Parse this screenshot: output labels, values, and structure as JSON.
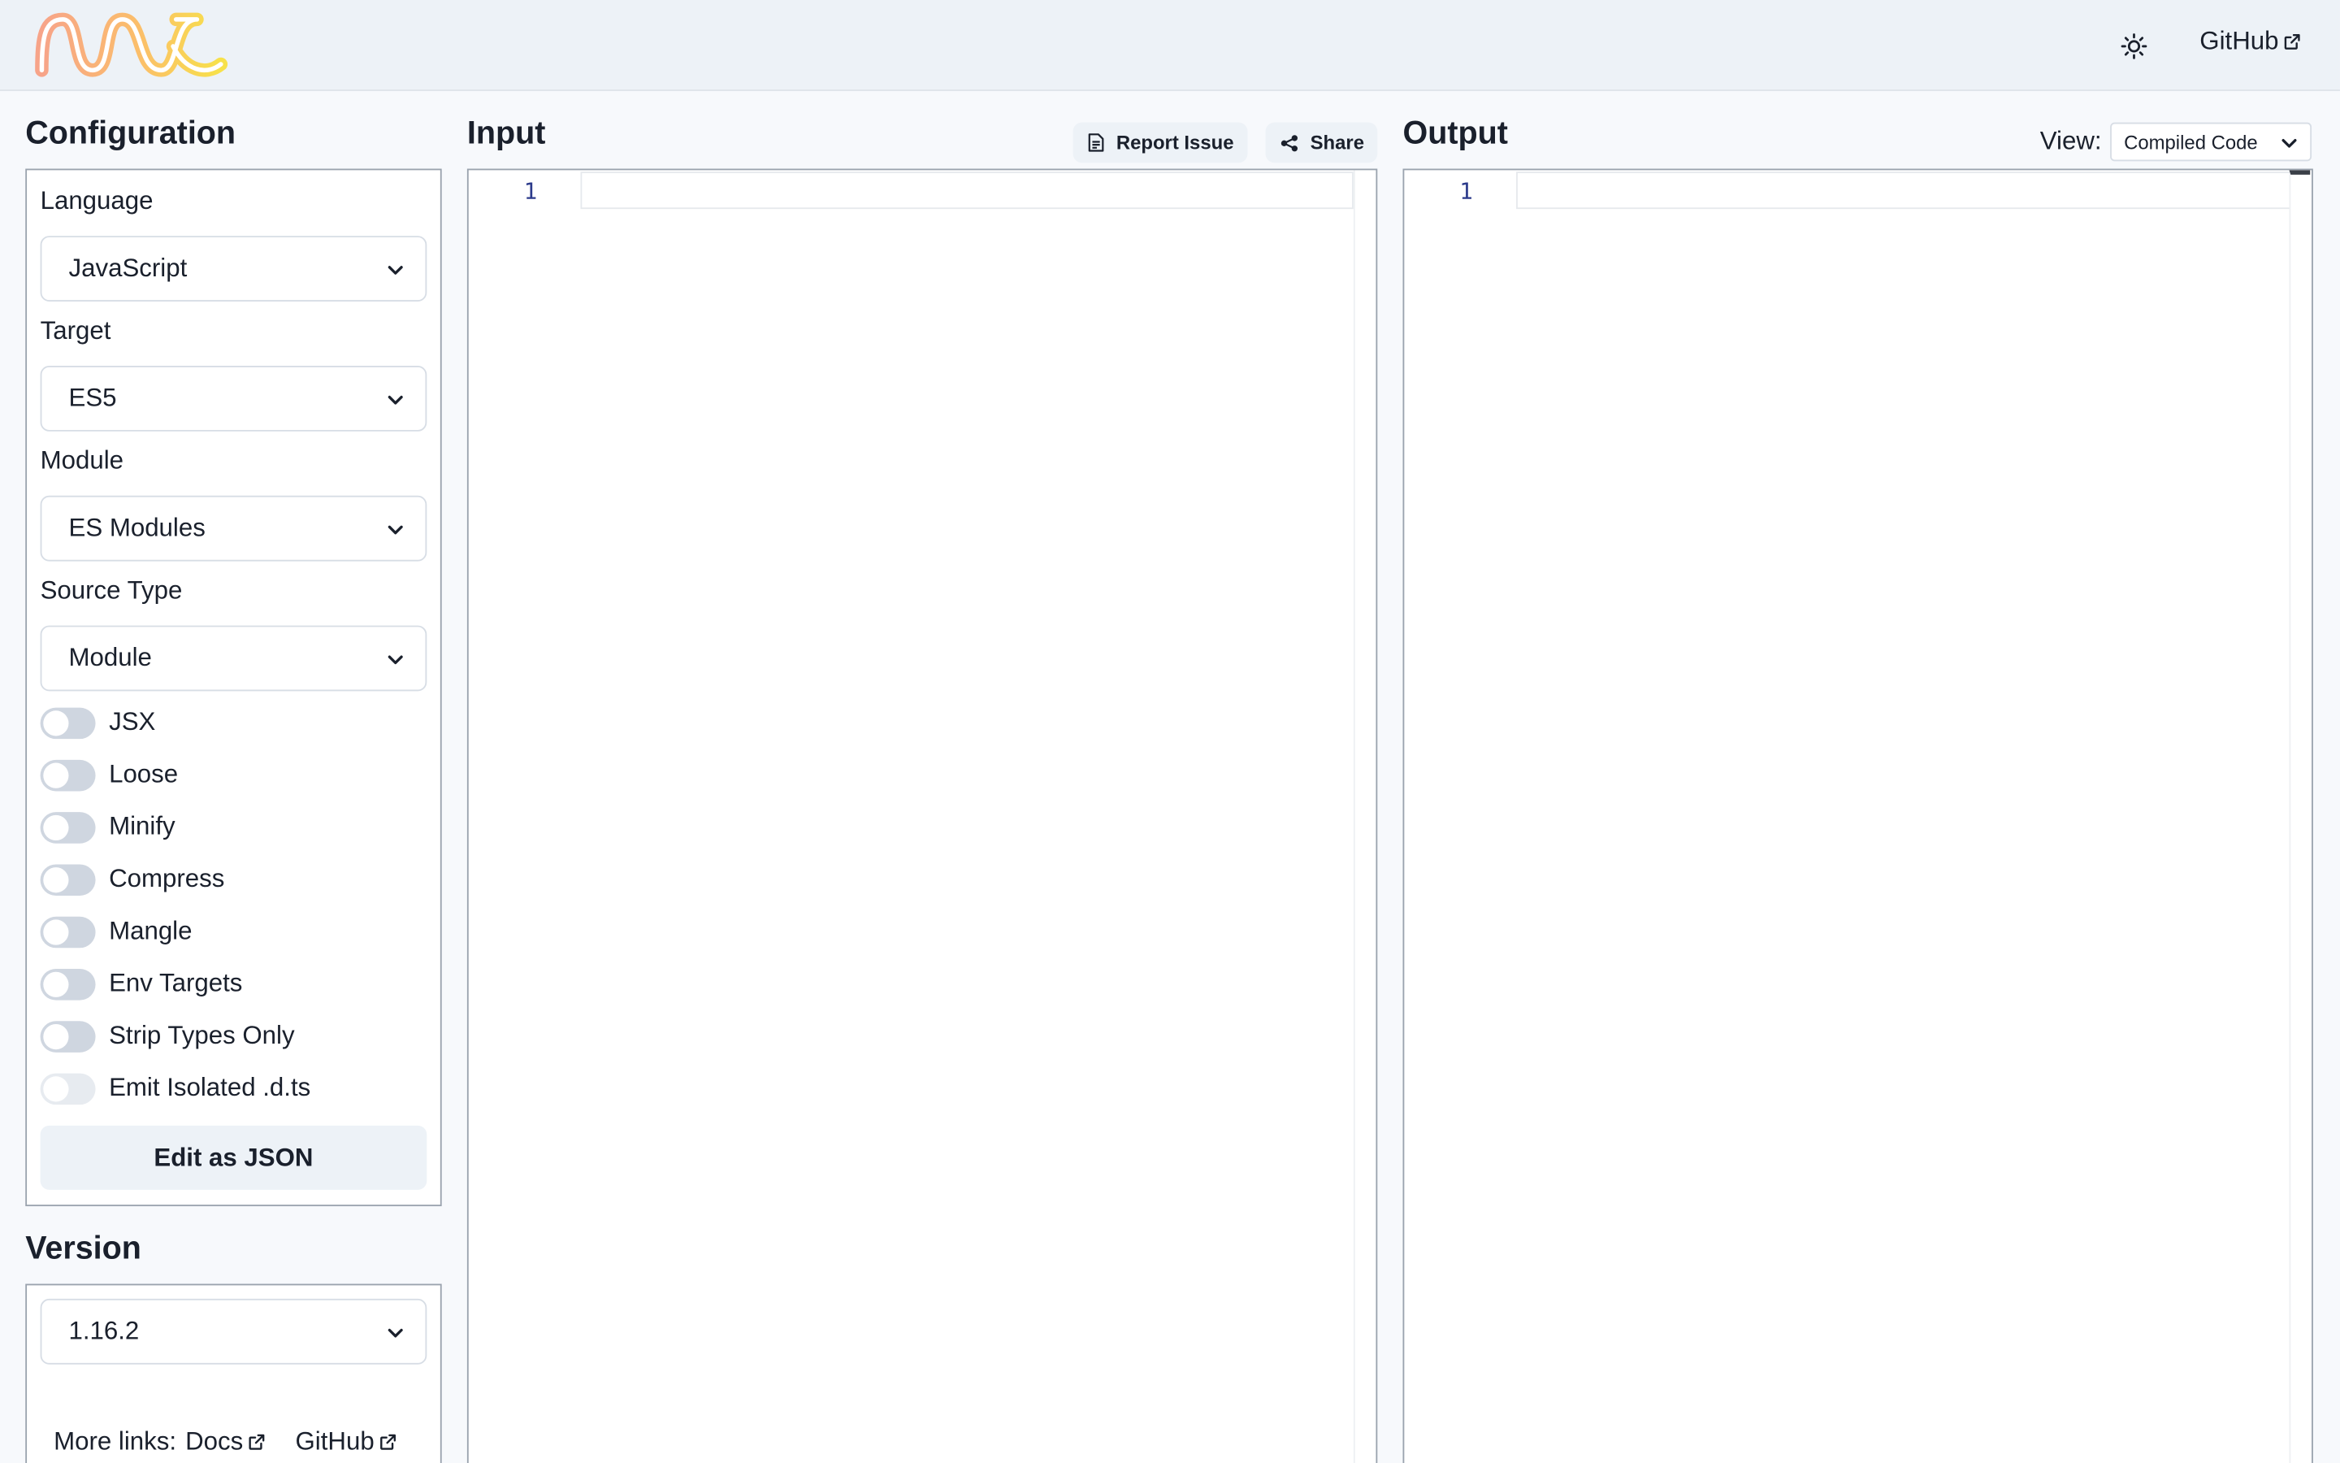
{
  "header": {
    "logo_icon": "swc-logo",
    "theme_icon": "sun-icon",
    "github_label": "GitHub"
  },
  "configuration": {
    "title": "Configuration",
    "language": {
      "label": "Language",
      "value": "JavaScript"
    },
    "target": {
      "label": "Target",
      "value": "ES5"
    },
    "module": {
      "label": "Module",
      "value": "ES Modules"
    },
    "source_type": {
      "label": "Source Type",
      "value": "Module"
    },
    "toggles": [
      {
        "label": "JSX",
        "checked": false,
        "disabled": false
      },
      {
        "label": "Loose",
        "checked": false,
        "disabled": false
      },
      {
        "label": "Minify",
        "checked": false,
        "disabled": false
      },
      {
        "label": "Compress",
        "checked": false,
        "disabled": false
      },
      {
        "label": "Mangle",
        "checked": false,
        "disabled": false
      },
      {
        "label": "Env Targets",
        "checked": false,
        "disabled": false
      },
      {
        "label": "Strip Types Only",
        "checked": false,
        "disabled": false
      },
      {
        "label": "Emit Isolated .d.ts",
        "checked": false,
        "disabled": true
      }
    ],
    "edit_json_label": "Edit as JSON"
  },
  "version": {
    "title": "Version",
    "value": "1.16.2",
    "more_links_label": "More links:",
    "docs_label": "Docs",
    "github_label": "GitHub"
  },
  "input": {
    "title": "Input",
    "report_issue_label": "Report Issue",
    "share_label": "Share",
    "line_number": "1"
  },
  "output": {
    "title": "Output",
    "view_label": "View:",
    "view_value": "Compiled Code",
    "line_number": "1"
  },
  "colors": {
    "header_bg": "#edf2f7",
    "page_bg": "#f7f9fc",
    "text": "#1a202c",
    "line_number": "#2b3a8b"
  }
}
